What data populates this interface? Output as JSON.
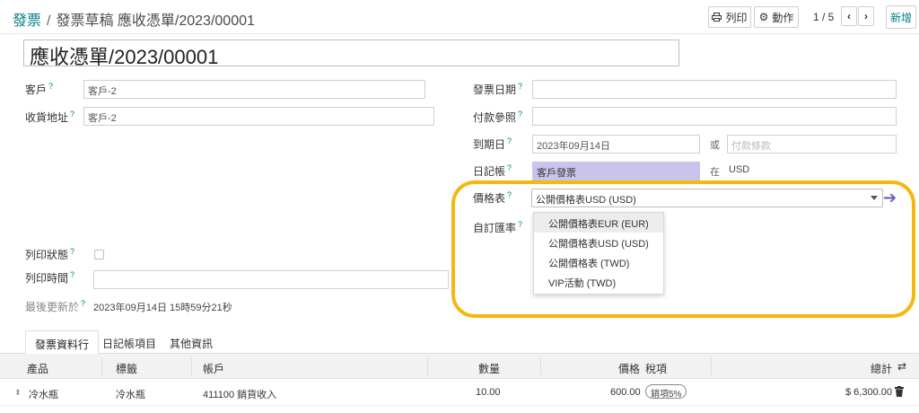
{
  "breadcrumb": {
    "root": "發票",
    "sep": "/",
    "current": "發票草稿 應收憑單/2023/00001"
  },
  "toolbar": {
    "print_label": "列印",
    "action_label": "動作",
    "pager": "1 / 5",
    "new_label": "新增"
  },
  "form": {
    "title": "應收憑單/2023/00001",
    "customer_label": "客戶",
    "customer_value": "客戶-2",
    "delivery_label": "收貨地址",
    "delivery_value": "客戶-2",
    "invoice_date_label": "發票日期",
    "invoice_date_value": "",
    "payment_ref_label": "付款參照",
    "payment_ref_value": "",
    "due_date_label": "到期日",
    "due_date_value": "2023年09月14日",
    "or_label": "或",
    "payment_terms_placeholder": "付款條款",
    "journal_label": "日記帳",
    "journal_value": "客戶發票",
    "in_label": "在",
    "currency": "USD",
    "pricelist_label": "價格表",
    "pricelist_value": "公開價格表USD (USD)",
    "custom_rate_label": "自訂匯率",
    "print_status_label": "列印狀態",
    "print_time_label": "列印時間",
    "last_updated_label": "最後更新於",
    "last_updated_value": "2023年09月14日 15時59分21秒",
    "help_mark": "?"
  },
  "pricelist_options": [
    "公開價格表EUR (EUR)",
    "公開價格表USD (USD)",
    "公開價格表 (TWD)",
    "VIP活動 (TWD)"
  ],
  "tabs": [
    "發票資料行",
    "日記帳項目",
    "其他資訊"
  ],
  "table": {
    "headers": {
      "product": "產品",
      "label": "標籤",
      "account": "帳戶",
      "qty": "數量",
      "price": "價格",
      "tax": "稅項",
      "total": "總計"
    },
    "row": {
      "product": "冷水瓶",
      "label": "冷水瓶",
      "account": "411100 銷貨收入",
      "qty": "10.00",
      "price": "600.00",
      "tax": "銷項5%",
      "total": "$ 6,300.00"
    }
  },
  "colors": {
    "accent": "#017e84",
    "annotation": "#f5b80e",
    "journal_highlight": "#c9c4ec"
  }
}
